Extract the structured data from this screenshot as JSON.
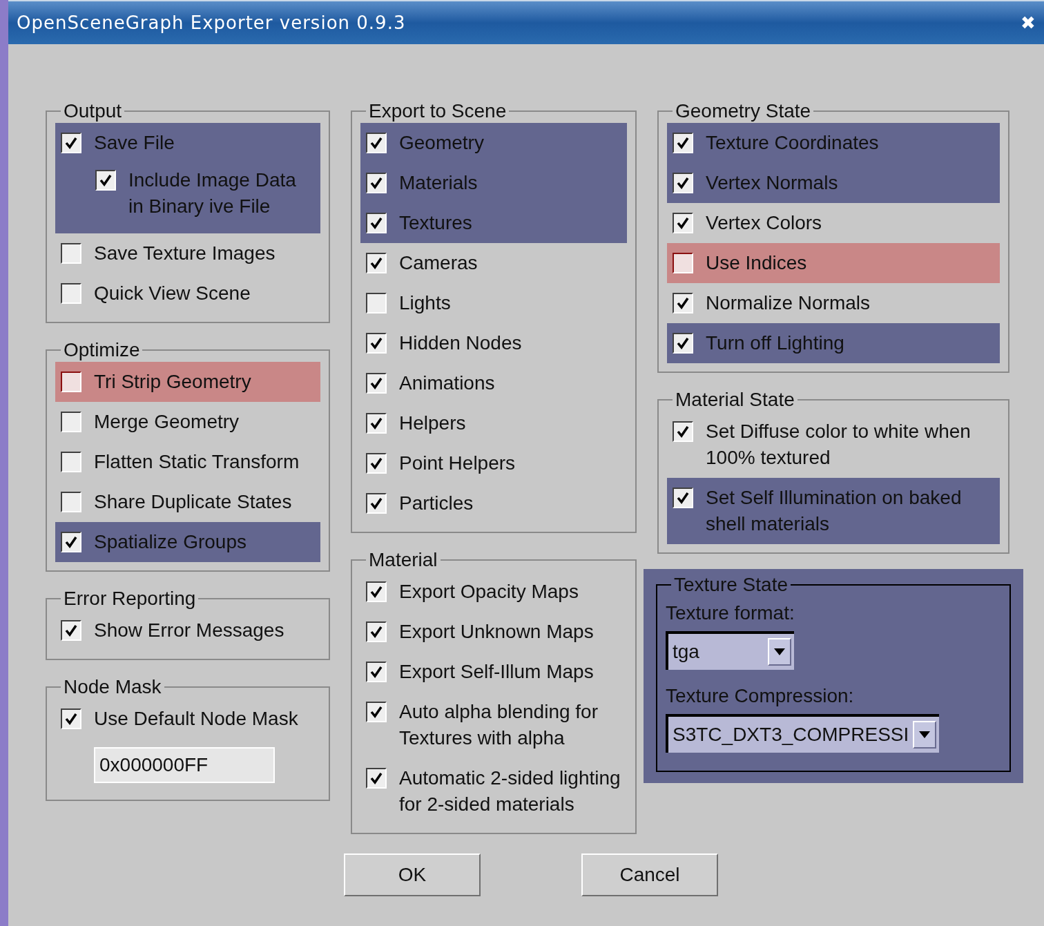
{
  "window": {
    "title": "OpenSceneGraph Exporter version 0.9.3",
    "close": "✖"
  },
  "columns": [
    [
      {
        "title": "Output",
        "items": [
          {
            "kind": "checkbox",
            "label": "Save File",
            "checked": true,
            "color": "#63668f",
            "children": [
              {
                "kind": "checkbox",
                "label": "Include Image Data in Binary ive File",
                "checked": true
              }
            ]
          },
          {
            "kind": "checkbox",
            "label": "Save Texture Images",
            "checked": false
          },
          {
            "kind": "checkbox",
            "label": "Quick View Scene",
            "checked": false
          }
        ]
      },
      {
        "title": "Optimize",
        "items": [
          {
            "kind": "checkbox",
            "label": "Tri Strip Geometry",
            "checked": false,
            "color": "#c98787"
          },
          {
            "kind": "checkbox",
            "label": "Merge Geometry",
            "checked": false
          },
          {
            "kind": "checkbox",
            "label": "Flatten Static Transform",
            "checked": false
          },
          {
            "kind": "checkbox",
            "label": "Share Duplicate States",
            "checked": false
          },
          {
            "kind": "checkbox",
            "label": "Spatialize Groups",
            "checked": true,
            "color": "#63668f"
          }
        ]
      },
      {
        "title": "Error Reporting",
        "items": [
          {
            "kind": "checkbox",
            "label": "Show Error Messages",
            "checked": true
          }
        ]
      },
      {
        "title": "Node Mask",
        "items": [
          {
            "kind": "checkbox",
            "label": "Use Default Node Mask",
            "checked": true
          },
          {
            "kind": "field",
            "value": "0x000000FF"
          }
        ]
      }
    ],
    [
      {
        "title": "Export to Scene",
        "items": [
          {
            "kind": "checkbox",
            "label": "Geometry",
            "checked": true,
            "color": "#63668f"
          },
          {
            "kind": "checkbox",
            "label": "Materials",
            "checked": true,
            "color": "#63668f"
          },
          {
            "kind": "checkbox",
            "label": "Textures",
            "checked": true,
            "color": "#63668f"
          },
          {
            "kind": "checkbox",
            "label": "Cameras",
            "checked": true
          },
          {
            "kind": "checkbox",
            "label": "Lights",
            "checked": false
          },
          {
            "kind": "checkbox",
            "label": "Hidden Nodes",
            "checked": true
          },
          {
            "kind": "checkbox",
            "label": "Animations",
            "checked": true
          },
          {
            "kind": "checkbox",
            "label": "Helpers",
            "checked": true
          },
          {
            "kind": "checkbox",
            "label": "Point Helpers",
            "checked": true
          },
          {
            "kind": "checkbox",
            "label": "Particles",
            "checked": true
          }
        ]
      },
      {
        "title": "Material",
        "items": [
          {
            "kind": "checkbox",
            "label": "Export Opacity Maps",
            "checked": true
          },
          {
            "kind": "checkbox",
            "label": "Export Unknown Maps",
            "checked": true
          },
          {
            "kind": "checkbox",
            "label": "Export Self-Illum Maps",
            "checked": true
          },
          {
            "kind": "checkbox",
            "label": "Auto alpha blending for Textures with alpha",
            "checked": true
          },
          {
            "kind": "checkbox",
            "label": "Automatic 2-sided lighting for 2-sided materials",
            "checked": true
          }
        ]
      }
    ],
    [
      {
        "title": "Geometry State",
        "items": [
          {
            "kind": "checkbox",
            "label": "Texture Coordinates",
            "checked": true,
            "color": "#63668f"
          },
          {
            "kind": "checkbox",
            "label": "Vertex Normals",
            "checked": true,
            "color": "#63668f"
          },
          {
            "kind": "checkbox",
            "label": "Vertex Colors",
            "checked": true
          },
          {
            "kind": "checkbox",
            "label": "Use Indices",
            "checked": false,
            "color": "#c98787"
          },
          {
            "kind": "checkbox",
            "label": "Normalize Normals",
            "checked": true
          },
          {
            "kind": "checkbox",
            "label": "Turn off Lighting",
            "checked": true,
            "color": "#63668f"
          }
        ]
      },
      {
        "title": "Material State",
        "items": [
          {
            "kind": "checkbox",
            "label": "Set Diffuse color to white when 100% textured",
            "checked": true
          },
          {
            "kind": "checkbox",
            "label": "Set Self Illumination on baked shell materials",
            "checked": true,
            "color": "#63668f"
          }
        ]
      },
      {
        "title": "Texture State",
        "color": "#63668f",
        "items": [
          {
            "kind": "label",
            "text": "Texture format:"
          },
          {
            "kind": "select",
            "value": "tga"
          },
          {
            "kind": "label",
            "text": "Texture Compression:"
          },
          {
            "kind": "select",
            "value": "S3TC_DXT3_COMPRESSI"
          }
        ]
      }
    ]
  ],
  "buttons": [
    "OK",
    "Cancel"
  ]
}
